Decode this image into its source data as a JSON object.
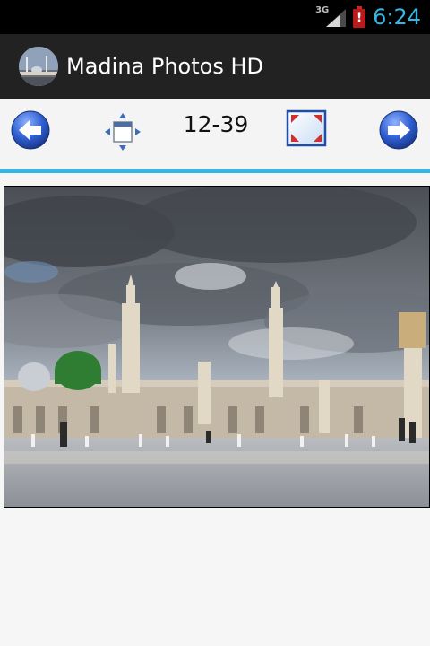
{
  "status_bar": {
    "network_label": "3G",
    "time": "6:24",
    "battery_alert": "!",
    "icons": [
      "signal-icon",
      "battery-alert-icon"
    ]
  },
  "action_bar": {
    "title": "Madina Photos HD",
    "icon": "app-icon"
  },
  "toolbar": {
    "counter": "12-39",
    "icons": [
      "previous-arrow-icon",
      "move-arrows-icon",
      "fullscreen-icon",
      "next-arrow-icon"
    ]
  },
  "colors": {
    "status_bar_bg": "#000000",
    "clock": "#33b5e5",
    "action_bar_bg": "#222222",
    "accent_line": "#33b5e5",
    "dome": "#2e7d32"
  }
}
